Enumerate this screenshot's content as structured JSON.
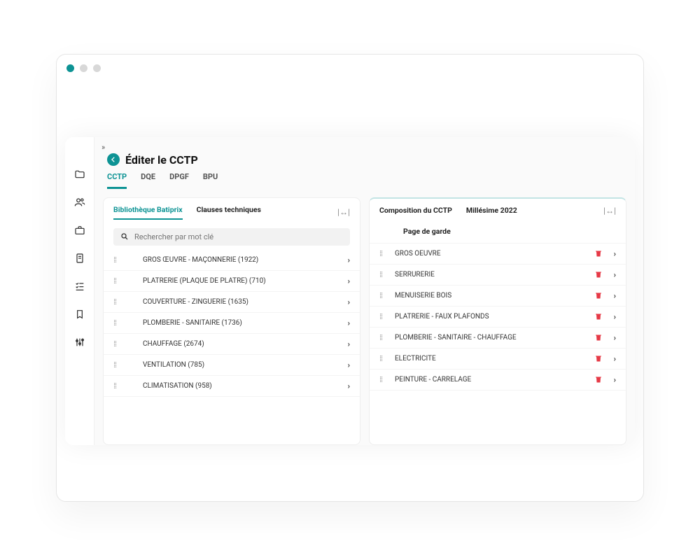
{
  "header": {
    "title": "Éditer le CCTP"
  },
  "tabs": [
    {
      "label": "CCTP",
      "active": true
    },
    {
      "label": "DQE",
      "active": false
    },
    {
      "label": "DPGF",
      "active": false
    },
    {
      "label": "BPU",
      "active": false
    }
  ],
  "left_panel": {
    "tabs": [
      {
        "label": "Bibliothèque Batiprix",
        "active": true
      },
      {
        "label": "Clauses techniques",
        "active": false
      }
    ],
    "search_placeholder": "Rechercher par mot clé",
    "items": [
      {
        "label": "GROS ŒUVRE - MAÇONNERIE (1922)"
      },
      {
        "label": "PLATRERIE (PLAQUE DE PLATRE) (710)"
      },
      {
        "label": "COUVERTURE - ZINGUERIE (1635)"
      },
      {
        "label": "PLOMBERIE - SANITAIRE (1736)"
      },
      {
        "label": "CHAUFFAGE (2674)"
      },
      {
        "label": "VENTILATION (785)"
      },
      {
        "label": "CLIMATISATION (958)"
      }
    ]
  },
  "right_panel": {
    "heading": "Composition du CCTP",
    "vintage": "Millésime 2022",
    "cover_page": "Page de garde",
    "items": [
      {
        "label": "GROS OEUVRE"
      },
      {
        "label": "SERRURERIE"
      },
      {
        "label": "MENUISERIE BOIS"
      },
      {
        "label": "PLATRERIE - FAUX PLAFONDS"
      },
      {
        "label": "PLOMBERIE - SANITAIRE - CHAUFFAGE"
      },
      {
        "label": "ELECTRICITE"
      },
      {
        "label": "PEINTURE - CARRELAGE"
      }
    ]
  },
  "icons": {
    "collapse": "|↔|"
  }
}
